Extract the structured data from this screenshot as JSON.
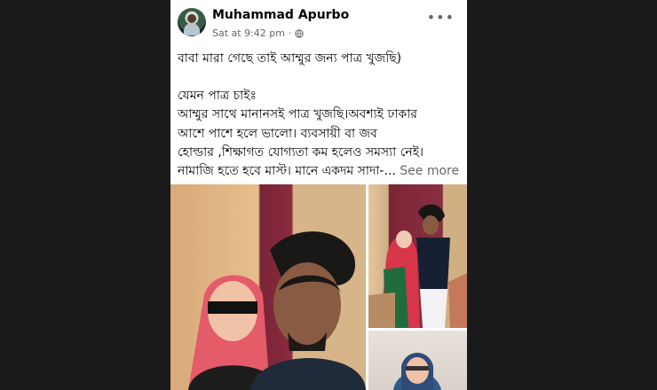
{
  "post": {
    "author": "Muhammad Apurbo",
    "time": "Sat at 9:42 pm",
    "privacy_sep": "·",
    "more_label": "•••",
    "lines": [
      "বাবা মারা গেছে তাই আম্মুর জন্য পাত্র খুজছি)",
      "যেমন পাত্র চাইঃ",
      "আম্মুর সাথে মানানসই  পাত্র খুজছি।অবশ্যই  ঢাকার",
      "আশে পাশে হলে ভালো। ব্যবসায়ী বা জব",
      "হোল্ডার ,শিক্ষাগত যোগ্যতা কম হলেও সমস্যা নেই।",
      "নামাজি হতে হবে মাস্ট। মানে একদম সাদা-..."
    ],
    "see_more": "See more"
  },
  "colors": {
    "frame": "#1a1a1a",
    "card": "#ffffff",
    "text": "#050505",
    "muted": "#65676b"
  }
}
